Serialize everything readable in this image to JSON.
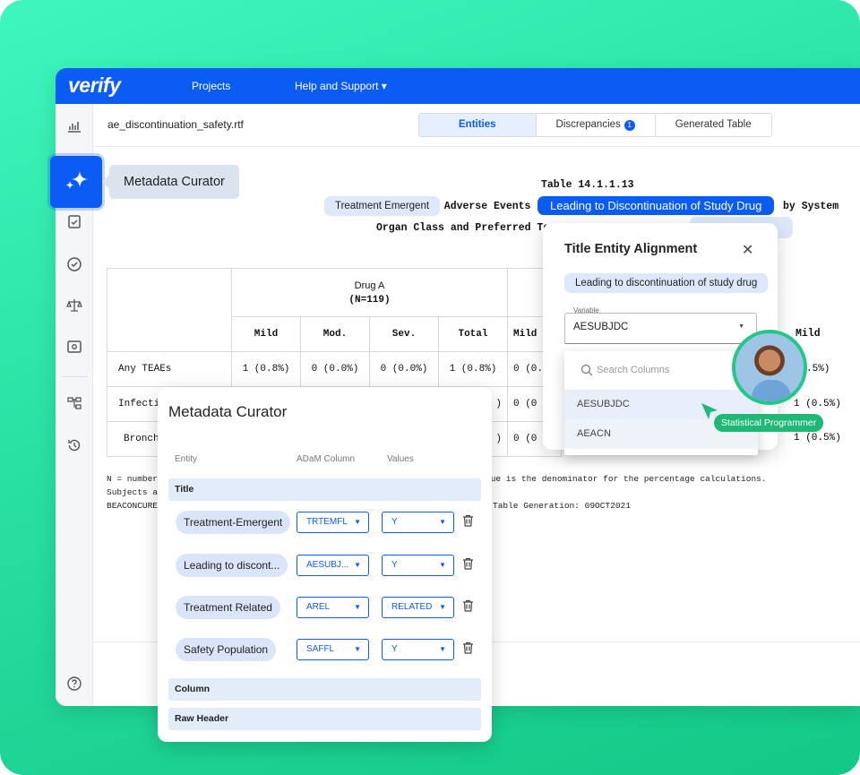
{
  "app": {
    "logo": "verify",
    "nav": [
      "Projects",
      "Help and Support"
    ],
    "nav_caret": "▾"
  },
  "filename": "ae_discontinuation_safety.rtf",
  "tabs": {
    "entities": "Entities",
    "discrepancies": "Discrepancies",
    "discrepancies_count": "1",
    "generated": "Generated Table"
  },
  "sidebar_icons": [
    "chart-icon",
    "clipboard-check-icon",
    "check-circle-icon",
    "scale-icon",
    "eye-icon",
    "hierarchy-icon",
    "history-icon",
    "help-icon"
  ],
  "curator_button": {
    "label": "Metadata Curator"
  },
  "document": {
    "table_num": "Table 14.1.1.13",
    "line1_pre": "t Adverse Events",
    "line1_post": "by System",
    "line2": "Organ Class and Preferred Te",
    "pill_te": "Treatment Emergent",
    "pill_ld": "Leading to Discontinuation of Study Drug",
    "drug_a": "Drug A",
    "drug_a_n": "(N=119)",
    "severity": [
      "Mild",
      "Mod.",
      "Sev.",
      "Total",
      "Mild"
    ],
    "severity_right": "Mild",
    "rows": [
      {
        "label": "Any TEAEs",
        "vals": [
          "1 (0.8%)",
          "0 (0.0%)",
          "0 (0.0%)",
          "1 (0.8%)",
          "0 (0."
        ],
        "right": ".5%)"
      },
      {
        "label": "Infecti",
        "vals": [
          "",
          "",
          "",
          ")",
          "0 (0"
        ],
        "right": "1 (0.5%)"
      },
      {
        "label": "Bronch",
        "vals": [
          "",
          "",
          "",
          ")",
          "0 (0"
        ],
        "right": "1 (0.5%)"
      }
    ],
    "note1_pre": "N = number",
    "note1_post": "lue is the denominator for the percentage calculations.",
    "note2": "Subjects a",
    "note3_pre": "BEACONCURE",
    "note3_post": "Table Generation: 09OCT2021"
  },
  "curator": {
    "title": "Metadata Curator",
    "col_entity": "Entity",
    "col_adam": "ADaM Column",
    "col_values": "Values",
    "sections": [
      "Title",
      "Column",
      "Raw Header"
    ],
    "rows": [
      {
        "entity": "Treatment-Emergent",
        "adam": "TRTEMFL",
        "value": "Y"
      },
      {
        "entity": "Leading to discont...",
        "adam": "AESUBJ...",
        "value": "Y"
      },
      {
        "entity": "Treatment Related",
        "adam": "AREL",
        "value": "RELATED"
      },
      {
        "entity": "Safety Population",
        "adam": "SAFFL",
        "value": "Y"
      }
    ]
  },
  "alignment": {
    "title": "Title Entity Alignment",
    "close": "✕",
    "entity": "Leading to discontinuation of study drug",
    "variable_label": "Variable",
    "variable_value": "AESUBJDC",
    "search_placeholder": "Search Columns",
    "options": [
      "AESUBJDC",
      "AEACN"
    ]
  },
  "user_tag": "Statistical Programmer",
  "colors": {
    "primary": "#0a5cf5",
    "green": "#1fb877"
  }
}
